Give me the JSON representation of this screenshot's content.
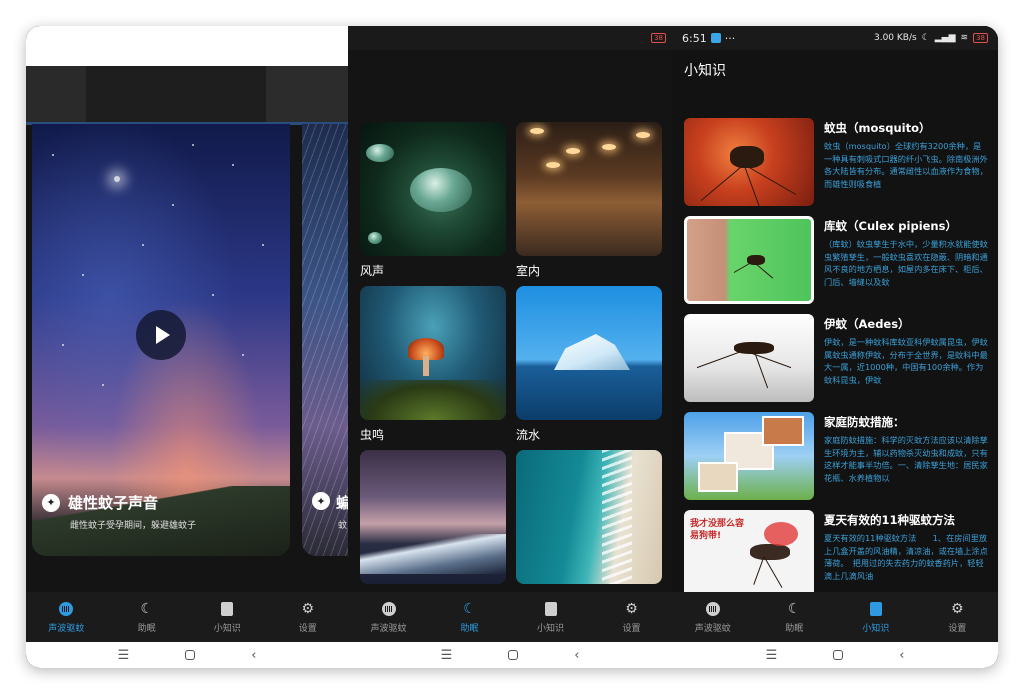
{
  "status_bar": {
    "time": "6:51",
    "more": "···",
    "network_speed": "3.00 KB/s",
    "battery": "38"
  },
  "panel1": {
    "card_title": "雄性蚊子声音",
    "card_subtitle": "雌性蚊子受孕期间，躲避雄蚊子",
    "peek_title": "蝙",
    "peek_subtitle": "蚊"
  },
  "panel2": {
    "tiles": [
      {
        "label": "风声"
      },
      {
        "label": "室内"
      },
      {
        "label": "虫鸣"
      },
      {
        "label": "流水"
      },
      {
        "label": ""
      },
      {
        "label": ""
      }
    ]
  },
  "panel3": {
    "title": "小知识",
    "tips": [
      {
        "title": "蚊虫（mosquito）",
        "body": "蚊虫（mosquito）全球约有3200余种，是一种具有刺吸式口器的纤小飞虫。除南极洲外各大陆皆有分布。通常雌性以血液作为食物，而雄性则吸食植"
      },
      {
        "title": "库蚊（Culex pipiens）",
        "body": "（库蚊）蚊虫孳生于水中，少量积水就能使蚊虫繁殖孳生，一般蚊虫喜欢在隐蔽、阴暗和通风不良的地方栖息，如屋内多在床下、柜后、门后、墙缝以及蚊"
      },
      {
        "title": "伊蚊（Aedes）",
        "body": "伊蚊，是一种蚊科库蚊亚科伊蚊属昆虫，伊蚊属蚊虫通称伊蚊，分布于全世界，是蚊科中最大一属，近1000种，中国有100余种。作为蚊科昆虫，伊蚊"
      },
      {
        "title": "家庭防蚊措施：",
        "body": "家庭防蚊措施：科学的灭蚊方法应该以清除孳生环境为主，辅以药物杀灭幼虫和成蚊，只有这样才能事半功倍。一、清除孳生地：居民家花瓶、水养植物以"
      },
      {
        "title": "夏天有效的11种驱蚊方法",
        "body": "夏天有效的11种驱蚊方法　　1、在房间里放上几盒开盖的风油精，清凉油，或在墙上涂点薄荷。　把用过的失去药力的蚊香药片，轻轻滴上几滴风油"
      }
    ],
    "cartoon_caption": "我才没那么容易狗带!"
  },
  "nav": {
    "items": [
      {
        "label": "声波驱蚊",
        "icon": "sound-wave-icon"
      },
      {
        "label": "助眠",
        "icon": "moon-icon"
      },
      {
        "label": "小知识",
        "icon": "book-icon"
      },
      {
        "label": "设置",
        "icon": "gear-icon"
      }
    ]
  },
  "system_nav": {
    "menu": "☰",
    "home": "",
    "back": "‹"
  },
  "colors": {
    "accent": "#2e9be0",
    "tip_text": "#3aa0d8",
    "background": "#141414"
  }
}
